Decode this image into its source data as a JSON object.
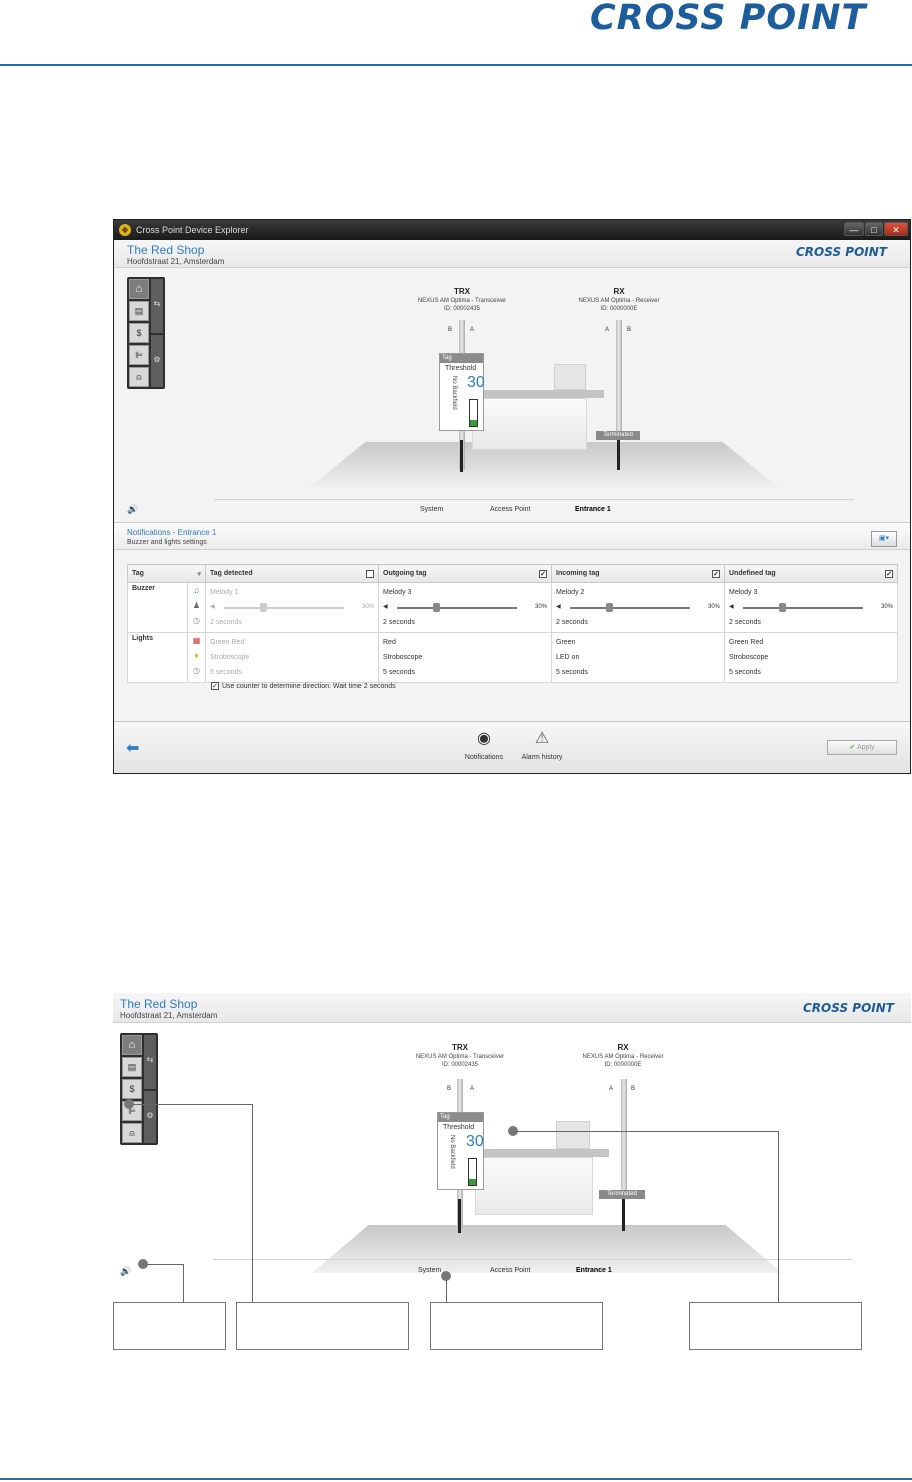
{
  "brand": "CROSS POINT",
  "window": {
    "title": "Cross Point Device Explorer",
    "minimize": "—",
    "maximize": "□",
    "close": "✕"
  },
  "shop": {
    "name": "The Red Shop",
    "address": "Hoofdstraat 21, Amsterdam"
  },
  "scene": {
    "trx": {
      "label": "TRX",
      "model": "NEXUS AM Optima - Transceiver",
      "id": "ID: 00002435",
      "a": "A",
      "b": "B"
    },
    "rx": {
      "label": "RX",
      "model": "NEXUS AM Optima - Receiver",
      "id": "ID: 0000000E",
      "id_upper": "ID: 0000000E",
      "a": "A",
      "b": "B"
    },
    "tag": {
      "header": "Tag",
      "threshold_label": "Threshold",
      "threshold": "30",
      "backfield": "No Backfield",
      "level_fraction": 0.25
    },
    "terminated": "Terminated"
  },
  "tabs": [
    "System",
    "Access Point",
    "Entrance 1"
  ],
  "active_tab": "Entrance 1",
  "notifications": {
    "title": "Notifications - Entrance 1",
    "subtitle": "Buzzer and lights settings",
    "columns": {
      "tag": "Tag",
      "detected": "Tag detected",
      "outgoing": "Outgoing tag",
      "incoming": "Incoming tag",
      "undefined": "Undefined tag"
    },
    "checked": {
      "detected": false,
      "outgoing": true,
      "incoming": true,
      "undefined": true
    },
    "rows": {
      "buzzer": "Buzzer",
      "lights": "Lights"
    },
    "buzzer": {
      "detected": {
        "melody": "Melody 1",
        "volume": "30%",
        "volume_fraction": 0.3,
        "duration": "2 seconds"
      },
      "outgoing": {
        "melody": "Melody 3",
        "volume": "30%",
        "volume_fraction": 0.3,
        "duration": "2 seconds"
      },
      "incoming": {
        "melody": "Melody 2",
        "volume": "30%",
        "volume_fraction": 0.3,
        "duration": "2 seconds"
      },
      "undefined": {
        "melody": "Melody 3",
        "volume": "30%",
        "volume_fraction": 0.3,
        "duration": "2 seconds"
      }
    },
    "lights": {
      "detected": {
        "color": "Green Red",
        "mode": "Stroboscope",
        "duration": "5 seconds"
      },
      "outgoing": {
        "color": "Red",
        "mode": "Stroboscope",
        "duration": "5 seconds"
      },
      "incoming": {
        "color": "Green",
        "mode": "LED on",
        "duration": "5 seconds"
      },
      "undefined": {
        "color": "Green Red",
        "mode": "Stroboscope",
        "duration": "5 seconds"
      }
    },
    "counter_option": "Use counter to determine direction: Wait time  2 seconds",
    "counter_checked": true
  },
  "footer": {
    "notifications": "Notifications",
    "alarm_history": "Alarm history",
    "apply": "Apply"
  },
  "lower": {
    "shop_name": "The Red Shop",
    "shop_address": "Hoofdstraat 21, Amsterdam",
    "rx_id": "ID: 0000000E"
  },
  "colors": {
    "accent": "#2f7cc0",
    "brand": "#1d5d9b",
    "ok_green": "#3a9a3a"
  }
}
